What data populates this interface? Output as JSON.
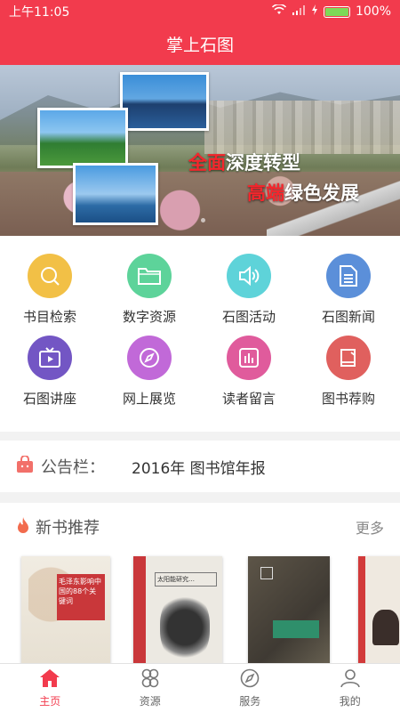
{
  "status": {
    "time": "上午11:05",
    "battery": "100%",
    "battery_level": 1.0
  },
  "app": {
    "title": "掌上石图"
  },
  "banner": {
    "slogan1": {
      "highlight": "全面",
      "rest": "深度转型"
    },
    "slogan2": {
      "highlight": "高端",
      "rest": "绿色发展"
    }
  },
  "grid": [
    {
      "label": "书目检索",
      "icon": "search-icon",
      "color": "#f2c046"
    },
    {
      "label": "数字资源",
      "icon": "folder-icon",
      "color": "#5dd39a"
    },
    {
      "label": "石图活动",
      "icon": "speaker-icon",
      "color": "#5ed3d9"
    },
    {
      "label": "石图新闻",
      "icon": "document-icon",
      "color": "#5b8fd9"
    },
    {
      "label": "石图讲座",
      "icon": "tv-play-icon",
      "color": "#7356c4"
    },
    {
      "label": "网上展览",
      "icon": "compass-icon",
      "color": "#c169d8"
    },
    {
      "label": "读者留言",
      "icon": "chart-icon",
      "color": "#e05b9c"
    },
    {
      "label": "图书荐购",
      "icon": "book-icon",
      "color": "#e0605e"
    }
  ],
  "notice": {
    "label": "公告栏：",
    "text": "2016年 图书馆年报"
  },
  "books": {
    "title": "新书推荐",
    "more": "更多",
    "covers": [
      {
        "text": "毛泽东影响中国的88个关键词"
      },
      {
        "text": "太阳能研究…"
      },
      {
        "text": ""
      },
      {
        "text": ""
      }
    ]
  },
  "tabs": [
    {
      "label": "主页",
      "icon": "home-icon"
    },
    {
      "label": "资源",
      "icon": "clover-icon"
    },
    {
      "label": "服务",
      "icon": "compass-icon"
    },
    {
      "label": "我的",
      "icon": "user-icon"
    }
  ],
  "colors": {
    "primary": "#f23b4d"
  }
}
